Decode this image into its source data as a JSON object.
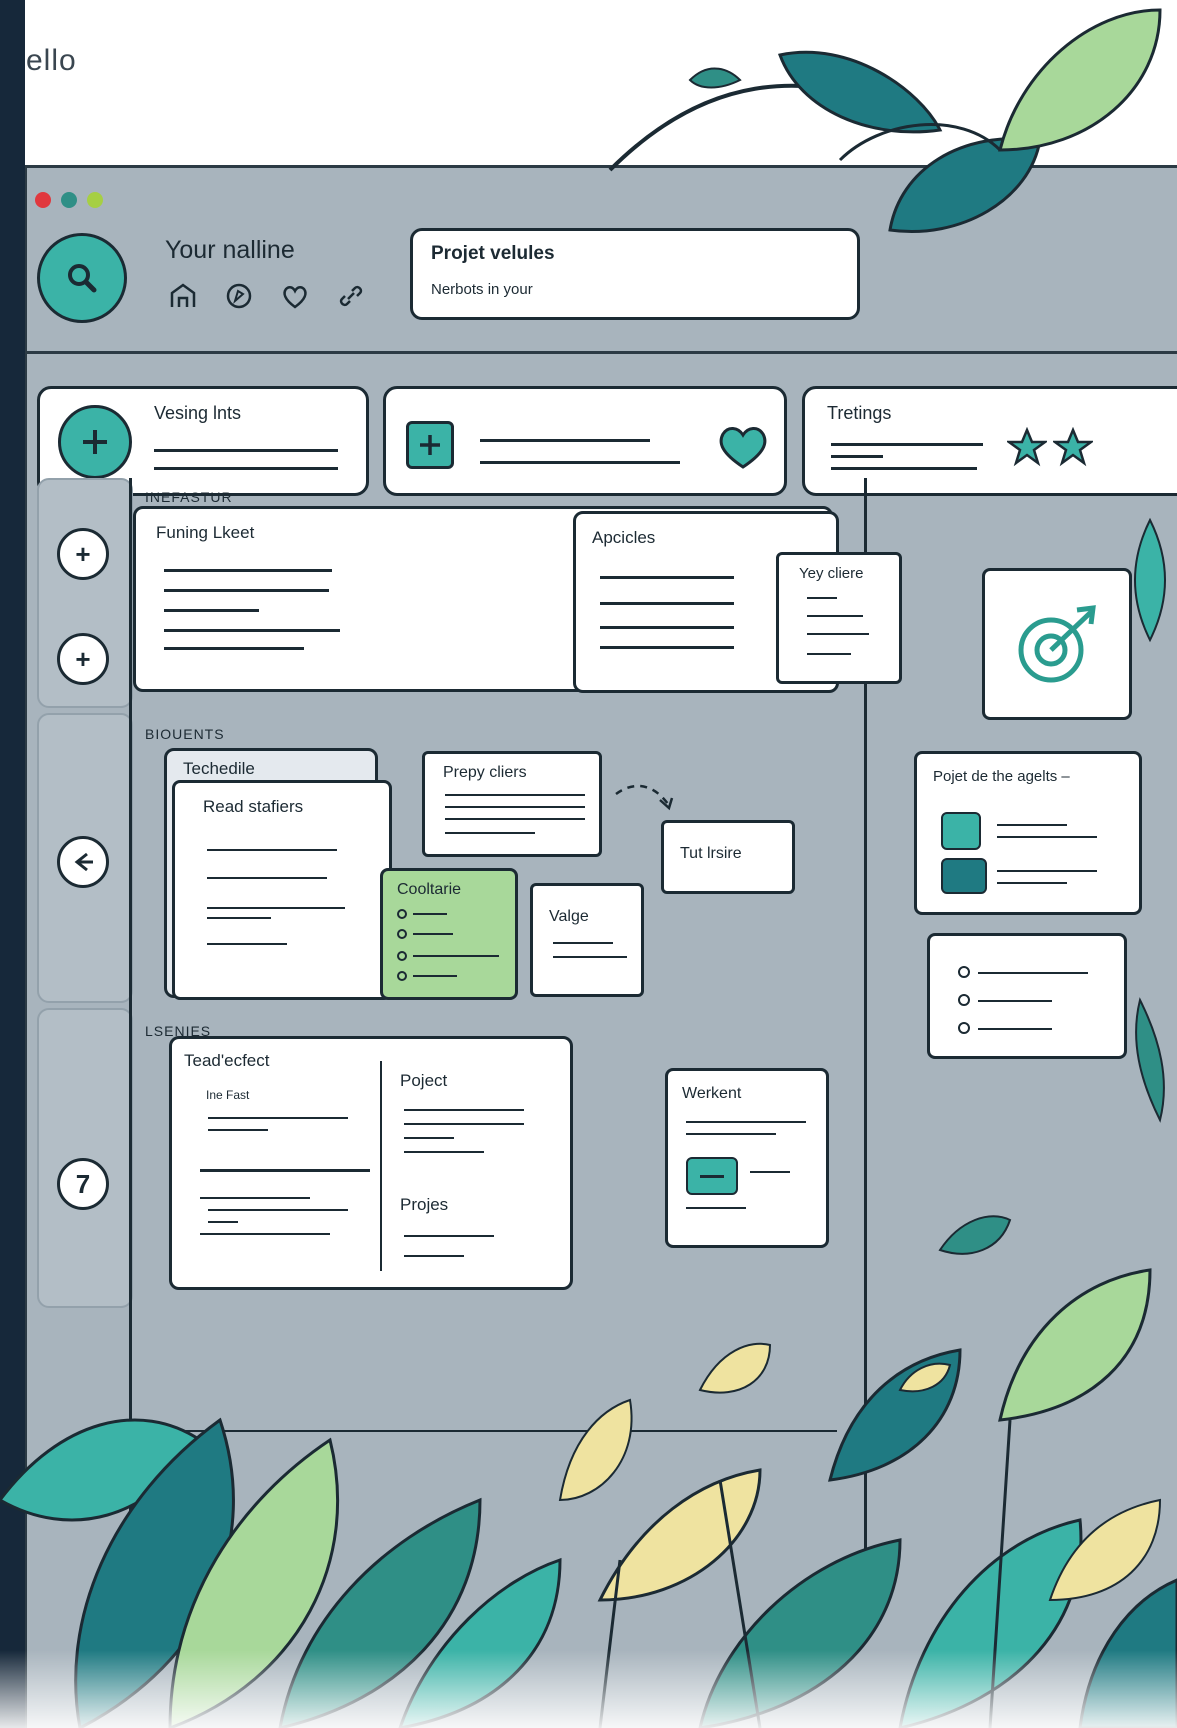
{
  "header": {
    "top_text": "ello"
  },
  "toolbar": {
    "name_label": "Your nalline",
    "project_title": "Projet velules",
    "project_sub": "Nerbots in your"
  },
  "top_cards": {
    "card1_title": "Vesing lnts",
    "card3_title": "Tretings"
  },
  "sections": {
    "section1_label": "INEFASTUR",
    "section2_label": "BIOUENTS",
    "section3_label": "LSENIES"
  },
  "cards": {
    "funning_title": "Funing Lkeet",
    "apcicles_title": "Apcicles",
    "yey_title": "Yey cliere",
    "techedule_title": "Techedile",
    "read_title": "Read stafiers",
    "prepy_title": "Prepy cliers",
    "tut_title": "Tut lrsire",
    "coolterie_title": "Cooltarie",
    "valge_title": "Valge",
    "projet_the_title": "Pojet de the agelts –",
    "tead_title": "Tead'ecfect",
    "tead_item": "Ine Fast",
    "poject_title": "Poject",
    "projes_title": "Projes",
    "werkent_title": "Werkent"
  },
  "colors": {
    "accent_teal": "#3bb3a7",
    "dark_teal": "#1f7a82",
    "window_gray": "#a8b4bd",
    "leaf_yellow": "#efe3a0",
    "leaf_green": "#a8d89a",
    "green_card": "#a8d89a"
  },
  "icons": [
    "search-icon",
    "home-icon",
    "compass-icon",
    "heart-outline-icon",
    "link-icon",
    "plus-icon",
    "heart-icon",
    "star-icon",
    "arrow-left-icon",
    "seven-icon",
    "target-icon"
  ]
}
